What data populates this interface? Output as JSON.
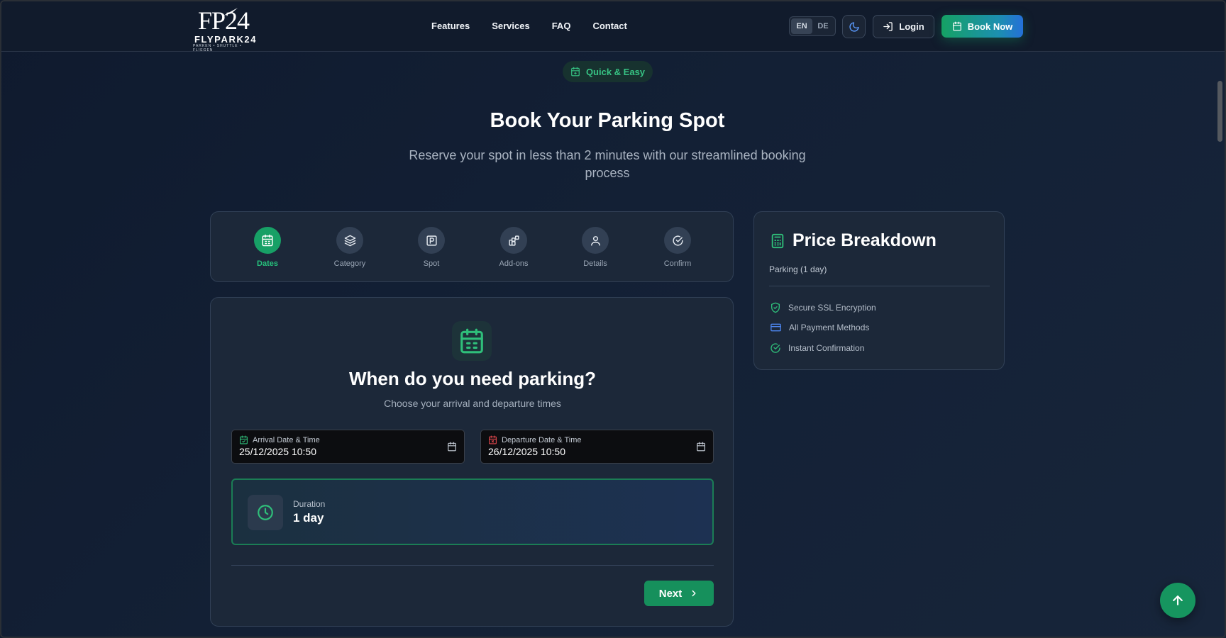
{
  "colors": {
    "accent_green": "#17a066",
    "accent_blue": "#2570d8",
    "departure_red": "#e5484d",
    "background": "#132035",
    "card": "#1c2839"
  },
  "header": {
    "logo": {
      "mark": "FP24",
      "name": "FLYPARK24",
      "tagline": "PARKEN • SHUTTLE • FLIEGEN"
    },
    "nav": [
      "Features",
      "Services",
      "FAQ",
      "Contact"
    ],
    "lang": {
      "options": [
        "EN",
        "DE"
      ],
      "selected": "EN"
    },
    "theme_icon": "moon-icon",
    "login_label": "Login",
    "book_label": "Book Now"
  },
  "hero": {
    "badge": "Quick & Easy",
    "title": "Book Your Parking Spot",
    "subtitle": "Reserve your spot in less than 2 minutes with our streamlined booking process"
  },
  "steps": [
    {
      "label": "Dates",
      "icon": "calendar-icon",
      "active": true
    },
    {
      "label": "Category",
      "icon": "layers-icon",
      "active": false
    },
    {
      "label": "Spot",
      "icon": "parking-icon",
      "active": false
    },
    {
      "label": "Add-ons",
      "icon": "addons-icon",
      "active": false
    },
    {
      "label": "Details",
      "icon": "user-icon",
      "active": false
    },
    {
      "label": "Confirm",
      "icon": "check-circle-icon",
      "active": false
    }
  ],
  "form": {
    "title": "When do you need parking?",
    "subtitle": "Choose your arrival and departure times",
    "arrival": {
      "label": "Arrival Date & Time",
      "value": "25/12/2025 10:50"
    },
    "departure": {
      "label": "Departure Date & Time",
      "value": "26/12/2025 10:50"
    },
    "duration": {
      "label": "Duration",
      "value": "1 day"
    },
    "next_label": "Next"
  },
  "price": {
    "title": "Price Breakdown",
    "line": "Parking (1 day)",
    "features": [
      {
        "label": "Secure SSL Encryption",
        "icon": "shield-check-icon"
      },
      {
        "label": "All Payment Methods",
        "icon": "credit-card-icon"
      },
      {
        "label": "Instant Confirmation",
        "icon": "check-circle-icon"
      }
    ]
  }
}
